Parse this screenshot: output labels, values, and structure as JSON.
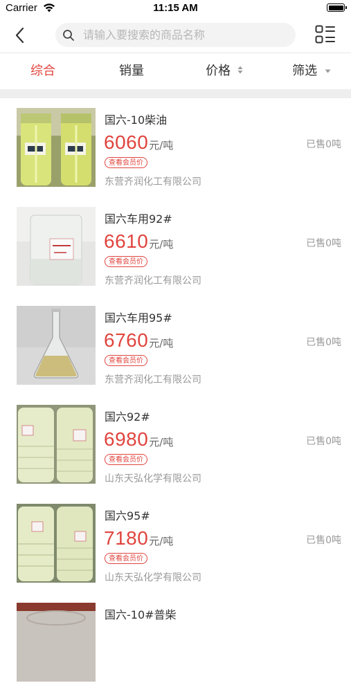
{
  "status_bar": {
    "carrier": "Carrier",
    "time": "11:15 AM"
  },
  "search": {
    "placeholder": "请输入要搜索的商品名称",
    "value": ""
  },
  "tabs": [
    {
      "label": "综合",
      "active": true
    },
    {
      "label": "销量"
    },
    {
      "label": "价格",
      "icon": "sort-arrows-icon"
    },
    {
      "label": "筛选",
      "icon": "caret-down-icon"
    }
  ],
  "products": [
    {
      "name": "国六-10柴油",
      "price": "6060",
      "unit": "元/吨",
      "member_label": "查看会员价",
      "sold": "已售0吨",
      "company": "东营齐润化工有限公司",
      "image": "two-plastic-bottles-yellow-oil"
    },
    {
      "name": "国六车用92#",
      "price": "6610",
      "unit": "元/吨",
      "member_label": "查看会员价",
      "sold": "已售0吨",
      "company": "东营齐润化工有限公司",
      "image": "clear-plastic-bottle-with-label"
    },
    {
      "name": "国六车用95#",
      "price": "6760",
      "unit": "元/吨",
      "member_label": "查看会员价",
      "sold": "已售0吨",
      "company": "东营齐润化工有限公司",
      "image": "glass-flask-yellow-liquid"
    },
    {
      "name": "国六92#",
      "price": "6980",
      "unit": "元/吨",
      "member_label": "查看会员价",
      "sold": "已售0吨",
      "company": "山东天弘化学有限公司",
      "image": "two-plastic-bottles-pale-oil"
    },
    {
      "name": "国六95#",
      "price": "7180",
      "unit": "元/吨",
      "member_label": "查看会员价",
      "sold": "已售0吨",
      "company": "山东天弘化学有限公司",
      "image": "two-plastic-bottles-pale-oil"
    },
    {
      "name": "国六-10#普柴",
      "image": "glass-beaker-dark-top"
    }
  ],
  "colors": {
    "accent": "#e0443e",
    "muted": "#999999",
    "divider": "#eeeeee"
  }
}
